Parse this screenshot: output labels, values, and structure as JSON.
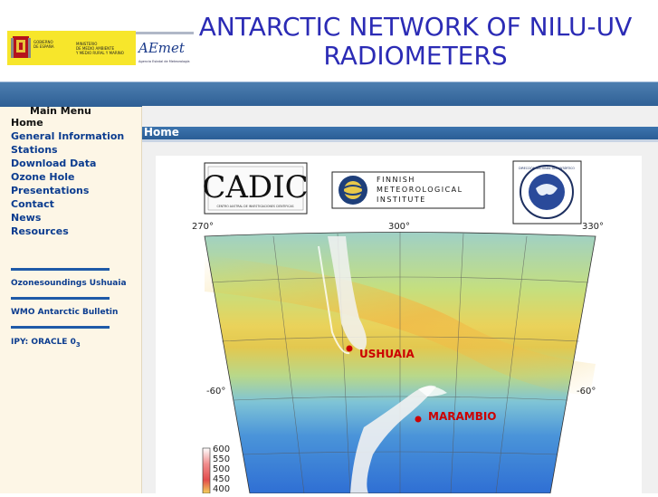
{
  "header": {
    "title_line1": "ANTARCTIC NETWORK OF NILU-UV",
    "title_line2": "RADIOMETERS",
    "logo_gobierno": [
      "GOBIERNO",
      "DE ESPAÑA"
    ],
    "logo_ministerio": [
      "MINISTERIO",
      "DE MEDIO AMBIENTE",
      "Y MEDIO RURAL Y MARINO"
    ],
    "logo_aemet": "AEmet",
    "logo_aemet_sub": "Agencia Estatal de Meteorología"
  },
  "sidebar": {
    "menu_title": "Main Menu",
    "items": [
      {
        "label": "Home",
        "active": true
      },
      {
        "label": "General Information"
      },
      {
        "label": "Stations"
      },
      {
        "label": "Download Data"
      },
      {
        "label": "Ozone Hole"
      },
      {
        "label": "Presentations"
      },
      {
        "label": "Contact"
      },
      {
        "label": "News"
      },
      {
        "label": "Resources"
      }
    ],
    "links": [
      {
        "label": "Ozonesoundings Ushuaia"
      },
      {
        "label": "WMO Antarctic Bulletin"
      },
      {
        "label": "IPY: ORACLE 0",
        "sub": "3"
      }
    ]
  },
  "content": {
    "section_title": "Home",
    "partner_logos": {
      "cadic": "CADIC",
      "cadic_sub": "CENTRO AUSTRAL DE INVESTIGACIONES CIENTIFICAS",
      "fmi": [
        "FINNISH",
        "METEOROLOGICAL",
        "INSTITUTE"
      ],
      "dna": "DIRECCIÓN NACIONAL DEL ANTÁRTICO"
    },
    "map": {
      "lon_labels": [
        "270°",
        "300°",
        "330°"
      ],
      "lat_labels": [
        "-60°",
        "-60°"
      ],
      "stations": [
        {
          "name": "USHUAIA",
          "color": "#cc0000"
        },
        {
          "name": "MARAMBIO",
          "color": "#cc0000"
        }
      ],
      "colorbar": [
        "600",
        "550",
        "500",
        "450",
        "400"
      ]
    }
  }
}
